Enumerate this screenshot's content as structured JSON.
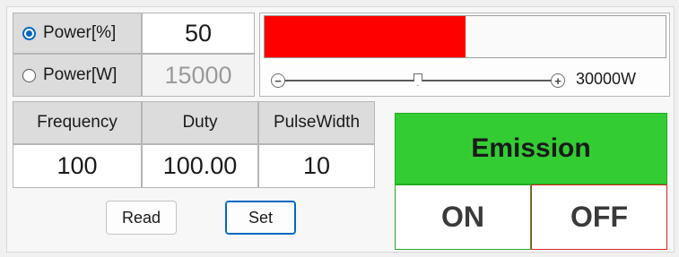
{
  "power_mode": {
    "percent_label": "Power[%]",
    "watt_label": "Power[W]",
    "percent_value": "50",
    "watt_value": "15000",
    "selected": "percent"
  },
  "power_bar": {
    "level_percent": 50,
    "fill_color": "#ff0000"
  },
  "slider": {
    "max_label": "30000W",
    "value_fraction": 0.5
  },
  "params": {
    "headers": [
      "Frequency",
      "Duty",
      "PulseWidth"
    ],
    "values": [
      "100",
      "100.00",
      "10"
    ]
  },
  "buttons": {
    "read": "Read",
    "set": "Set"
  },
  "emission": {
    "title": "Emission",
    "on": "ON",
    "off": "OFF",
    "header_color": "#33cc33",
    "on_border": "#22aa22",
    "off_border": "#dd2222"
  }
}
